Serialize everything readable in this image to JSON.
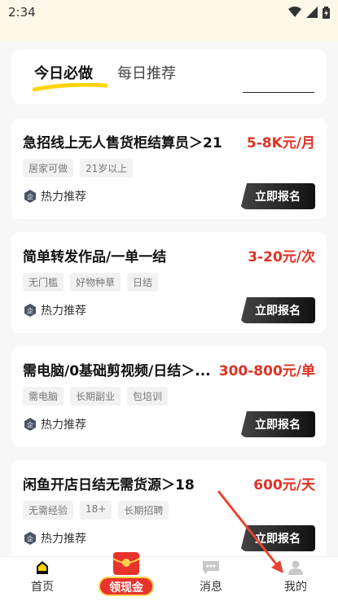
{
  "status_bar": {
    "time": "2:34"
  },
  "tabs": [
    {
      "label": "今日必做",
      "active": true
    },
    {
      "label": "每日推荐",
      "active": false
    }
  ],
  "jobs": [
    {
      "title": "急招线上无人售货柜结算员＞21",
      "pay": "5-8K元/月",
      "tags": [
        "居家可做",
        "21岁以上"
      ],
      "rec_label": "热力推荐",
      "apply_label": "立即报名"
    },
    {
      "title": "简单转发作品/一单一结",
      "pay": "3-20元/次",
      "tags": [
        "无门槛",
        "好物种草",
        "日结"
      ],
      "rec_label": "热力推荐",
      "apply_label": "立即报名"
    },
    {
      "title": "需电脑/0基础剪视频/日结＞...",
      "pay": "300-800元/单",
      "tags": [
        "需电脑",
        "长期副业",
        "包培训"
      ],
      "rec_label": "热力推荐",
      "apply_label": "立即报名"
    },
    {
      "title": "闲鱼开店日结无需货源＞18",
      "pay": "600元/天",
      "tags": [
        "无需经验",
        "18+",
        "长期招聘"
      ],
      "rec_label": "热力推荐",
      "apply_label": "立即报名"
    }
  ],
  "bottom_nav": {
    "home": "首页",
    "cash": "领现金",
    "messages": "消息",
    "profile": "我的"
  },
  "colors": {
    "accent_yellow": "#ffd400",
    "pay_red": "#e03224",
    "annotation_arrow": "#e5452f"
  }
}
